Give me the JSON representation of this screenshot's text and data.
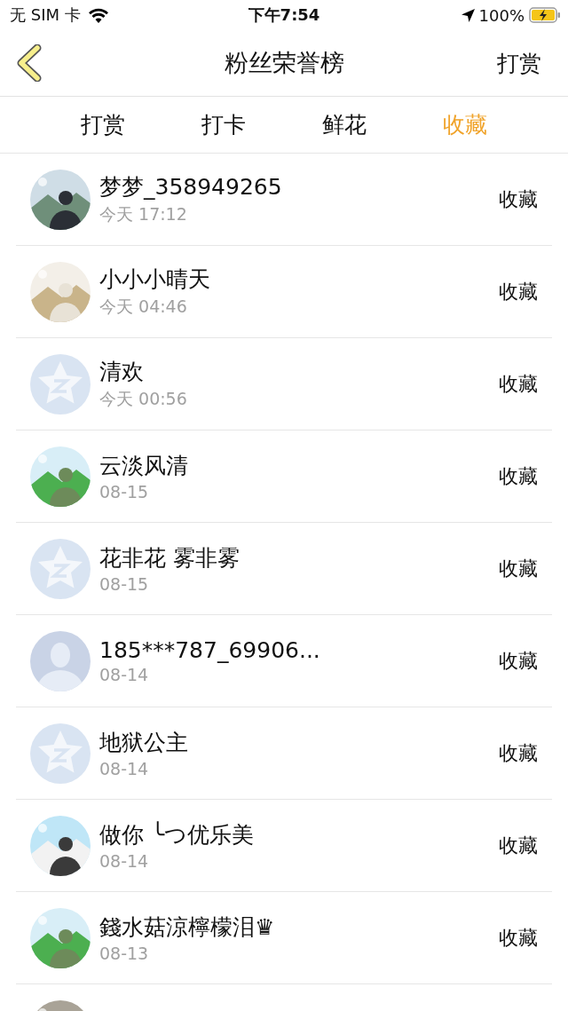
{
  "status_bar": {
    "carrier": "无 SIM 卡",
    "time": "下午7:54",
    "battery": "100%"
  },
  "nav": {
    "title": "粉丝荣誉榜",
    "action": "打赏"
  },
  "tabs": [
    {
      "label": "打赏",
      "selected": false
    },
    {
      "label": "打卡",
      "selected": false
    },
    {
      "label": "鲜花",
      "selected": false
    },
    {
      "label": "收藏",
      "selected": true
    }
  ],
  "rows": [
    {
      "kind": "picture",
      "name": "梦梦_358949265",
      "time": "今天 17:12",
      "action": "收藏"
    },
    {
      "kind": "picture",
      "name": "小小小晴天",
      "time": "今天 04:46",
      "action": "收藏"
    },
    {
      "kind": "star",
      "name": "清欢",
      "time": "今天 00:56",
      "action": "收藏"
    },
    {
      "kind": "picture",
      "name": "云淡风清",
      "time": "08-15",
      "action": "收藏"
    },
    {
      "kind": "star",
      "name": "花非花 雾非雾",
      "time": "08-15",
      "action": "收藏"
    },
    {
      "kind": "silhouette",
      "name": "185***787_69906...",
      "time": "08-14",
      "action": "收藏"
    },
    {
      "kind": "star",
      "name": "地狱公主",
      "time": "08-14",
      "action": "收藏"
    },
    {
      "kind": "picture",
      "name": "做你 ╰つ优乐美",
      "time": "08-14",
      "action": "收藏"
    },
    {
      "kind": "picture",
      "name": "錢水菇涼檸檬泪♛",
      "time": "08-13",
      "action": "收藏"
    },
    {
      "kind": "picture"
    }
  ]
}
